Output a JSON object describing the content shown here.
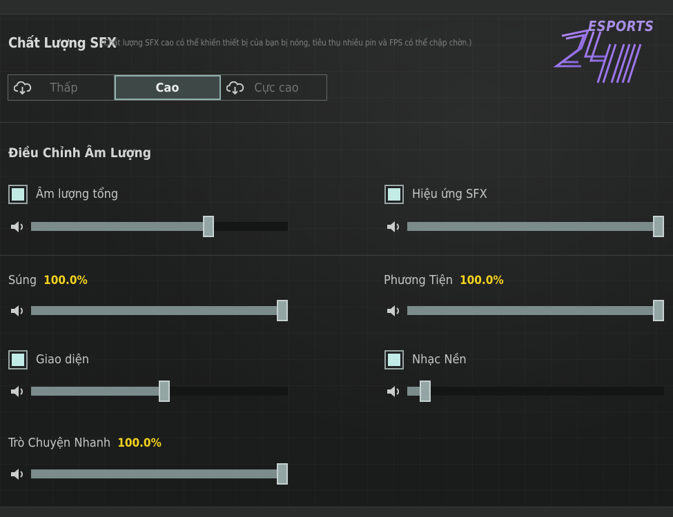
{
  "sfx_quality": {
    "title": "Chất Lượng SFX",
    "note": "(Chất lượng SFX cao có thể khiến thiết bị của bạn bị nóng, tiêu thụ nhiều pin và FPS có thể chập chờn.)",
    "options": [
      {
        "label": "Thấp",
        "icon": "cloud-download-icon"
      },
      {
        "label": "Cao",
        "icon": ""
      },
      {
        "label": "Cực cao",
        "icon": "cloud-download-icon"
      }
    ],
    "selected": "Cao"
  },
  "volume": {
    "title": "Điều Chỉnh Âm Lượng",
    "master": {
      "label": "Âm lượng tổng",
      "checked": true,
      "value": 0.7
    },
    "sfx": {
      "label": "Hiệu ứng SFX",
      "checked": true,
      "value": 1.0
    },
    "guns": {
      "label": "Súng",
      "percent": "100.0%",
      "value": 1.0
    },
    "vehicles": {
      "label": "Phương Tiện",
      "percent": "100.0%",
      "value": 1.0
    },
    "ui": {
      "label": "Giao diện",
      "checked": true,
      "value": 0.52
    },
    "music": {
      "label": "Nhạc Nền",
      "checked": true,
      "value": 0.05
    },
    "quick_chat": {
      "label": "Trò Chuyện Nhanh",
      "percent": "100.0%",
      "value": 1.0
    }
  },
  "watermark": {
    "brand": "ESPORTS",
    "mark": "24H"
  },
  "colors": {
    "accent_yellow": "#f2d31d",
    "slider_fill": "#7b8c8b",
    "checkbox_fill": "#c3ebe6",
    "logo": "#a98fe8"
  }
}
